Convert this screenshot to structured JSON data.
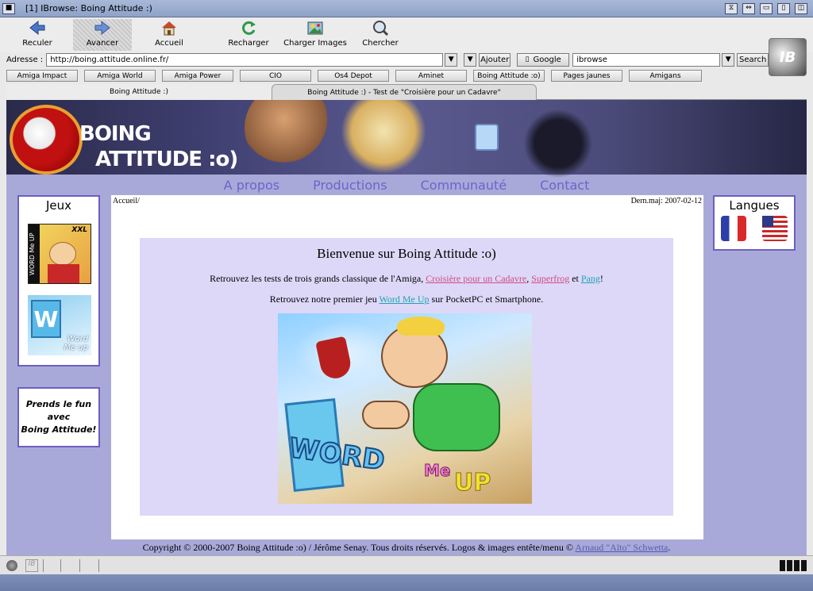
{
  "window": {
    "title": "[1] IBrowse: Boing Attitude :)"
  },
  "toolbar": {
    "back": "Reculer",
    "forward": "Avancer",
    "home": "Accueil",
    "reload": "Recharger",
    "load_images": "Charger Images",
    "search": "Chercher",
    "logo": "IB"
  },
  "address": {
    "label": "Adresse :",
    "value": "http://boing.attitude.online.fr/",
    "add_button": "Ajouter",
    "engine_button": "Google",
    "search_value": "ibrowse",
    "search_button": "Search"
  },
  "bookmarks": [
    "Amiga Impact",
    "Amiga World",
    "Amiga Power",
    "CIO",
    "Os4 Depot",
    "Aminet",
    "Boing Attitude :o)",
    "Pages jaunes",
    "Amigans"
  ],
  "tabs": [
    "Boing Attitude :)",
    "Boing Attitude :) - Test de \"Croisière pour un Cadavre\""
  ],
  "page": {
    "banner_line1": "BOING",
    "banner_line2": "ATTITUDE :o)",
    "menu": [
      "A propos",
      "Productions",
      "Communauté",
      "Contact"
    ],
    "jeux_title": "Jeux",
    "game1_label": "XXL",
    "game1_side": "WORD Me UP",
    "game2_label": "Word Me up",
    "promo": [
      "Prends le fun",
      "avec",
      "Boing Attitude!"
    ],
    "breadcrumb": "Accueil/",
    "last_update": "Dern.maj: 2007-02-12",
    "headline": "Bienvenue sur Boing Attitude :o)",
    "para1_prefix": "Retrouvez les tests de trois grands classique de l'Amiga, ",
    "para1_link1": "Croisière pour un Cadavre",
    "para1_sep1": ", ",
    "para1_link2": "Superfrog",
    "para1_sep2": " et ",
    "para1_link3": "Pang",
    "para1_suffix": "!",
    "para2_prefix": "Retrouvez notre premier jeu ",
    "para2_link": "Word Me Up",
    "para2_suffix": " sur PocketPC et Smartphone.",
    "art_word": "WORD",
    "art_me": "Me",
    "art_up": "UP",
    "langues_title": "Langues",
    "footer_text": "Copyright © 2000-2007 Boing Attitude :o) / Jérôme Senay. Tous droits réservés. Logos & images entête/menu © ",
    "footer_link": "Arnaud \"Aïto\" Schwetta",
    "footer_end": "."
  },
  "colors": {
    "accent": "#6b5fc0",
    "menu": "#6666cc",
    "page_bg": "#a9a9d9",
    "panel": "#ddd8f8"
  }
}
